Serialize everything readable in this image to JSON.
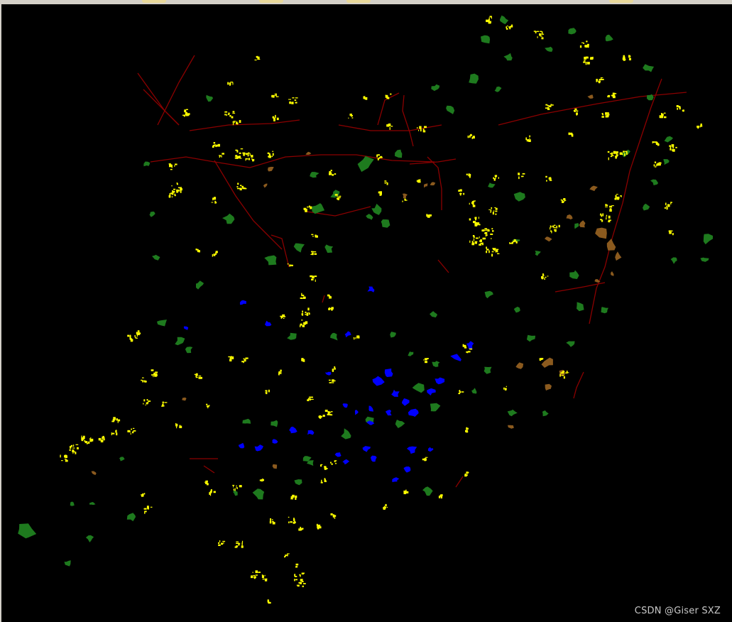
{
  "watermark": "CSDN @Giser SXZ",
  "colors": {
    "background": "#000000",
    "roads": "#8b0000",
    "settlements": "#ffff00",
    "vegetation": "#1e7a1e",
    "water": "#0000ff",
    "bare_land": "#8b5a1e"
  },
  "layers": [
    {
      "name": "roads",
      "color": "#8b0000"
    },
    {
      "name": "settlements",
      "color": "#ffff00"
    },
    {
      "name": "vegetation",
      "color": "#1e7a1e"
    },
    {
      "name": "water",
      "color": "#0000ff"
    },
    {
      "name": "bare_land",
      "color": "#8b5a1e"
    }
  ]
}
